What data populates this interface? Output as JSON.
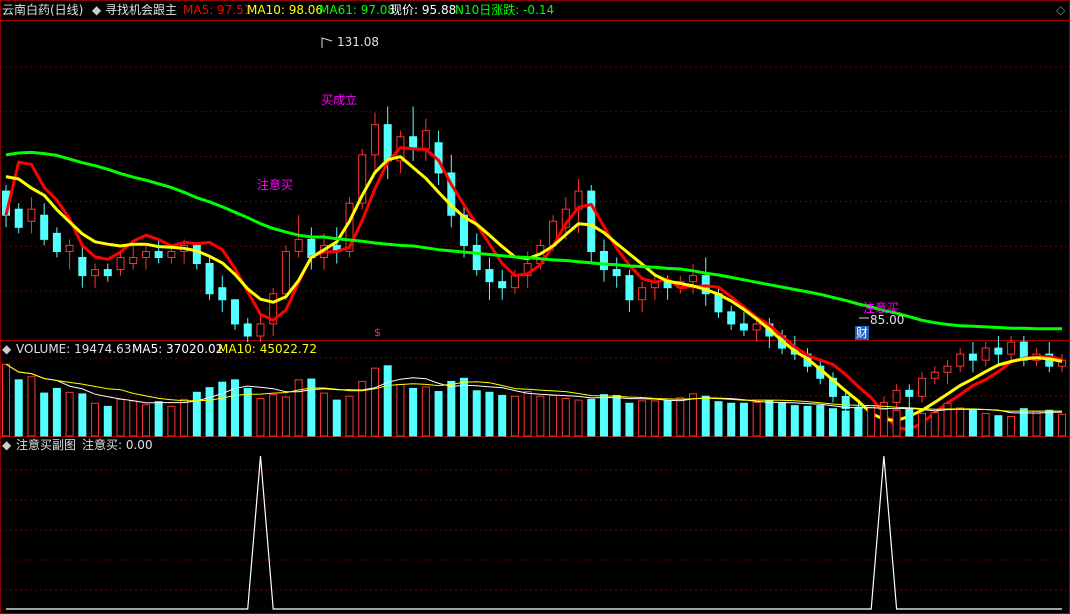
{
  "header": {
    "stock_name": "云南白药(日线)",
    "indicator_name": "寻找机会跟主",
    "ma5": "MA5: 97.51",
    "ma10": "MA10: 98.06",
    "ma61": "MA61: 97.08",
    "price": "现价: 95.88",
    "n10": "N10日涨跌: -0.14"
  },
  "volume_header": {
    "title": "VOLUME: 19474.63",
    "ma5": "MA5: 37020.02",
    "ma10": "MA10: 45022.72"
  },
  "sub_header": {
    "title": "注意买副图",
    "value": "注意买: 0.00"
  },
  "annotations": {
    "high": "131.08",
    "low": "85.00",
    "buy_signal_1": "注意买",
    "buy_signal_2": "注意买",
    "buy_confirmed": "买成立",
    "finance_marker": "财",
    "dollar_marker": "$"
  },
  "colors": {
    "up": "#ff3232",
    "down": "#54ffff",
    "ma5": "#ff0000",
    "ma10": "#ffff00",
    "ma61": "#00ff00",
    "grid": "#6b0000",
    "vol_ma5": "#ffffff",
    "vol_ma10": "#ffff00",
    "signal_text": "#ff00ff"
  },
  "chart_data": [
    {
      "type": "candlestick",
      "title": "云南白药(日线)",
      "ylim": [
        84,
        136
      ],
      "series": [
        {
          "name": "MA5",
          "values": [
            104,
            112.8,
            112.4,
            108.6,
            106.5,
            103.4,
            99.0,
            97.1,
            96.7,
            97.9,
            99.7,
            100.7,
            100.0,
            98.9,
            99.5,
            99.3,
            99.5,
            98.3,
            95.2,
            91.3,
            87.6,
            86.6,
            88.3,
            92.9,
            97.1,
            97.9,
            98.0,
            98.7,
            103.1,
            108.4,
            112.8,
            115.2,
            115.0,
            114.9,
            113.1,
            109.1,
            105.7,
            102.5,
            99.2,
            96.0,
            94.0,
            94.3,
            95.8,
            98.9,
            102.6,
            105.3,
            105.8,
            102.1,
            98.5,
            95.7,
            93.5,
            92.9,
            93.4,
            92.0,
            92.2,
            92.3,
            92.1,
            90.5,
            88.8,
            87.1,
            85.8,
            84.0,
            82.2,
            80.8,
            80.0,
            79.3,
            77.6,
            75.6,
            73.8,
            71.2,
            68.8,
            68.5,
            69.6,
            71.3,
            72.9,
            74.3,
            75.8,
            76.8,
            78.1,
            79.7,
            80.3,
            80.5,
            80.6,
            80.1
          ]
        },
        {
          "name": "MA10",
          "values": [
            110.4,
            110.0,
            108.5,
            107.3,
            104.9,
            102.9,
            100.9,
            99.6,
            99.2,
            98.9,
            99.2,
            99.2,
            98.8,
            98.7,
            98.5,
            98.1,
            97.2,
            96.1,
            94.2,
            91.8,
            90.1,
            89.6,
            90.5,
            93.2,
            97.0,
            98.3,
            99.6,
            103.0,
            107.3,
            111.1,
            113.2,
            113.7,
            111.9,
            110.1,
            107.8,
            105.6,
            103.7,
            102.5,
            100.7,
            98.8,
            97.1,
            96.8,
            97.6,
            98.9,
            100.8,
            102.6,
            102.4,
            101.1,
            99.3,
            97.6,
            95.9,
            94.1,
            93.1,
            92.7,
            92.3,
            91.7,
            90.9,
            89.8,
            88.4,
            86.8,
            85.1,
            83.2,
            81.5,
            80.2,
            78.5,
            76.7,
            74.9,
            73.2,
            71.2,
            70.2,
            70.0,
            70.7,
            71.7,
            73.0,
            74.4,
            75.8,
            76.9,
            78.1,
            79.2,
            79.8,
            80.2,
            80.4,
            80.2,
            79.8
          ]
        },
        {
          "name": "MA61",
          "values": [
            114,
            114.3,
            114.4,
            114.2,
            113.9,
            113.3,
            112.7,
            112.2,
            111.6,
            110.9,
            110.3,
            109.8,
            109.2,
            108.6,
            107.8,
            106.9,
            106.2,
            105.4,
            104.5,
            103.6,
            102.6,
            101.8,
            101.2,
            100.7,
            100.4,
            100.4,
            100.1,
            99.9,
            99.7,
            99.4,
            99.2,
            99.0,
            98.9,
            98.6,
            98.3,
            98.1,
            97.9,
            97.7,
            97.5,
            97.3,
            97.1,
            97.0,
            96.8,
            96.6,
            96.5,
            96.3,
            96.1,
            95.9,
            95.8,
            95.6,
            95.5,
            95.4,
            95.2,
            95.1,
            94.8,
            94.4,
            94.1,
            93.7,
            93.3,
            92.9,
            92.5,
            92.1,
            91.7,
            91.3,
            90.9,
            90.4,
            89.9,
            89.3,
            88.8,
            88.2,
            87.8,
            87.2,
            86.6,
            86.2,
            85.9,
            85.7,
            85.6,
            85.5,
            85.4,
            85.3,
            85.3,
            85.2,
            85.2,
            85.2
          ]
        }
      ],
      "candles": [
        {
          "o": 108,
          "h": 109,
          "c": 104,
          "l": 102
        },
        {
          "o": 105,
          "h": 106,
          "c": 102,
          "l": 101
        },
        {
          "o": 103,
          "h": 107,
          "c": 105,
          "l": 101
        },
        {
          "o": 104,
          "h": 106,
          "c": 100,
          "l": 99
        },
        {
          "o": 101,
          "h": 102,
          "c": 98,
          "l": 97
        },
        {
          "o": 98,
          "h": 100,
          "c": 99,
          "l": 95
        },
        {
          "o": 97,
          "h": 99,
          "c": 94,
          "l": 92
        },
        {
          "o": 94,
          "h": 96,
          "c": 95,
          "l": 92
        },
        {
          "o": 95,
          "h": 96,
          "c": 94,
          "l": 93
        },
        {
          "o": 95,
          "h": 98,
          "c": 97,
          "l": 94
        },
        {
          "o": 96,
          "h": 99,
          "c": 97,
          "l": 95
        },
        {
          "o": 97,
          "h": 99,
          "c": 98,
          "l": 95
        },
        {
          "o": 98,
          "h": 100,
          "c": 97,
          "l": 96
        },
        {
          "o": 97,
          "h": 99,
          "c": 98,
          "l": 96
        },
        {
          "o": 98,
          "h": 100,
          "c": 99,
          "l": 96
        },
        {
          "o": 99,
          "h": 99,
          "c": 96,
          "l": 95
        },
        {
          "o": 96,
          "h": 97,
          "c": 91,
          "l": 90
        },
        {
          "o": 92,
          "h": 94,
          "c": 90,
          "l": 88
        },
        {
          "o": 90,
          "h": 90,
          "c": 86,
          "l": 85
        },
        {
          "o": 86,
          "h": 87,
          "c": 84,
          "l": 83
        },
        {
          "o": 84,
          "h": 88,
          "c": 86,
          "l": 83
        },
        {
          "o": 86,
          "h": 92,
          "c": 91,
          "l": 84
        },
        {
          "o": 91,
          "h": 99,
          "c": 98,
          "l": 90
        },
        {
          "o": 98,
          "h": 104,
          "c": 100,
          "l": 97
        },
        {
          "o": 100,
          "h": 102,
          "c": 97,
          "l": 95
        },
        {
          "o": 97,
          "h": 101,
          "c": 99,
          "l": 95
        },
        {
          "o": 99,
          "h": 102,
          "c": 98,
          "l": 96
        },
        {
          "o": 98,
          "h": 107,
          "c": 106,
          "l": 97
        },
        {
          "o": 106,
          "h": 115,
          "c": 114,
          "l": 105
        },
        {
          "o": 114,
          "h": 121,
          "c": 119,
          "l": 111
        },
        {
          "o": 119,
          "h": 122,
          "c": 113,
          "l": 110
        },
        {
          "o": 113,
          "h": 118,
          "c": 117,
          "l": 111
        },
        {
          "o": 117,
          "h": 122,
          "c": 115,
          "l": 113
        },
        {
          "o": 115,
          "h": 120,
          "c": 118,
          "l": 113
        },
        {
          "o": 116,
          "h": 118,
          "c": 111,
          "l": 109
        },
        {
          "o": 111,
          "h": 114,
          "c": 104,
          "l": 102
        },
        {
          "o": 104,
          "h": 106,
          "c": 99,
          "l": 97
        },
        {
          "o": 99,
          "h": 101,
          "c": 95,
          "l": 94
        },
        {
          "o": 95,
          "h": 97,
          "c": 93,
          "l": 90
        },
        {
          "o": 93,
          "h": 95,
          "c": 92,
          "l": 90
        },
        {
          "o": 92,
          "h": 95,
          "c": 94,
          "l": 91
        },
        {
          "o": 94,
          "h": 98,
          "c": 96,
          "l": 92
        },
        {
          "o": 96,
          "h": 100,
          "c": 99,
          "l": 95
        },
        {
          "o": 99,
          "h": 104,
          "c": 103,
          "l": 98
        },
        {
          "o": 102,
          "h": 107,
          "c": 105,
          "l": 100
        },
        {
          "o": 105,
          "h": 110,
          "c": 108,
          "l": 101
        },
        {
          "o": 108,
          "h": 109,
          "c": 98,
          "l": 96
        },
        {
          "o": 98,
          "h": 100,
          "c": 95,
          "l": 93
        },
        {
          "o": 95,
          "h": 97,
          "c": 94,
          "l": 92
        },
        {
          "o": 94,
          "h": 95,
          "c": 90,
          "l": 88
        },
        {
          "o": 90,
          "h": 93,
          "c": 92,
          "l": 88
        },
        {
          "o": 92,
          "h": 94,
          "c": 93,
          "l": 90
        },
        {
          "o": 93,
          "h": 94,
          "c": 92,
          "l": 90
        },
        {
          "o": 92,
          "h": 94,
          "c": 93,
          "l": 91
        },
        {
          "o": 93,
          "h": 96,
          "c": 94,
          "l": 91
        },
        {
          "o": 94,
          "h": 97,
          "c": 91,
          "l": 89
        },
        {
          "o": 91,
          "h": 92,
          "c": 88,
          "l": 87
        },
        {
          "o": 88,
          "h": 89,
          "c": 86,
          "l": 85
        },
        {
          "o": 86,
          "h": 88,
          "c": 85,
          "l": 84
        },
        {
          "o": 85,
          "h": 87,
          "c": 86,
          "l": 83
        },
        {
          "o": 86,
          "h": 87,
          "c": 84,
          "l": 82
        },
        {
          "o": 84,
          "h": 85,
          "c": 82,
          "l": 81
        },
        {
          "o": 82,
          "h": 84,
          "c": 81,
          "l": 80
        },
        {
          "o": 81,
          "h": 82,
          "c": 79,
          "l": 78
        },
        {
          "o": 79,
          "h": 80,
          "c": 77,
          "l": 76
        },
        {
          "o": 77,
          "h": 78,
          "c": 74,
          "l": 73
        },
        {
          "o": 74,
          "h": 75,
          "c": 72,
          "l": 71
        },
        {
          "o": 72,
          "h": 73,
          "c": 70,
          "l": 69
        },
        {
          "o": 70,
          "h": 72,
          "c": 70,
          "l": 68
        },
        {
          "o": 70,
          "h": 74,
          "c": 73,
          "l": 69
        },
        {
          "o": 73,
          "h": 76,
          "c": 75,
          "l": 72
        },
        {
          "o": 75,
          "h": 76,
          "c": 74,
          "l": 72
        },
        {
          "o": 74,
          "h": 78,
          "c": 77,
          "l": 73
        },
        {
          "o": 77,
          "h": 79,
          "c": 78,
          "l": 76
        },
        {
          "o": 78,
          "h": 80,
          "c": 79,
          "l": 76
        },
        {
          "o": 79,
          "h": 82,
          "c": 81,
          "l": 78
        },
        {
          "o": 81,
          "h": 83,
          "c": 80,
          "l": 78
        },
        {
          "o": 80,
          "h": 83,
          "c": 82,
          "l": 79
        },
        {
          "o": 82,
          "h": 84,
          "c": 81,
          "l": 79
        },
        {
          "o": 81,
          "h": 84,
          "c": 83,
          "l": 80
        },
        {
          "o": 83,
          "h": 84,
          "c": 80,
          "l": 79
        },
        {
          "o": 80,
          "h": 82,
          "c": 81,
          "l": 79
        },
        {
          "o": 81,
          "h": 83,
          "c": 79,
          "l": 78
        },
        {
          "o": 79,
          "h": 81,
          "c": 80,
          "l": 78
        }
      ]
    },
    {
      "type": "bar",
      "title": "VOLUME",
      "ylim": [
        0,
        100
      ],
      "values": [
        92,
        72,
        76,
        55,
        61,
        56,
        54,
        42,
        38,
        47,
        45,
        40,
        44,
        38,
        47,
        56,
        62,
        69,
        72,
        61,
        48,
        53,
        50,
        72,
        73,
        55,
        46,
        51,
        70,
        87,
        90,
        66,
        61,
        63,
        57,
        70,
        74,
        58,
        56,
        52,
        51,
        57,
        51,
        52,
        48,
        46,
        47,
        53,
        52,
        42,
        45,
        45,
        45,
        49,
        54,
        51,
        44,
        42,
        42,
        43,
        45,
        43,
        39,
        38,
        39,
        35,
        32,
        37,
        39,
        34,
        33,
        35,
        29,
        30,
        42,
        36,
        33,
        29,
        26,
        25,
        35,
        32,
        33,
        28
      ],
      "up_flags": [
        1,
        0,
        1,
        0,
        0,
        1,
        0,
        1,
        0,
        1,
        1,
        1,
        0,
        1,
        1,
        0,
        0,
        0,
        0,
        0,
        1,
        1,
        1,
        1,
        0,
        1,
        0,
        1,
        1,
        1,
        0,
        1,
        0,
        1,
        0,
        0,
        0,
        0,
        0,
        0,
        1,
        1,
        1,
        1,
        1,
        1,
        0,
        0,
        0,
        0,
        1,
        1,
        0,
        1,
        1,
        0,
        0,
        0,
        0,
        1,
        0,
        0,
        0,
        0,
        0,
        0,
        0,
        0,
        1,
        1,
        1,
        0,
        1,
        1,
        1,
        1,
        0,
        1,
        0,
        1,
        0,
        1,
        0,
        1
      ]
    },
    {
      "type": "line",
      "title": "注意买副图",
      "ylim": [
        0,
        1
      ],
      "spikes_at_index": [
        20,
        69
      ],
      "values_note": "注意买"
    }
  ]
}
